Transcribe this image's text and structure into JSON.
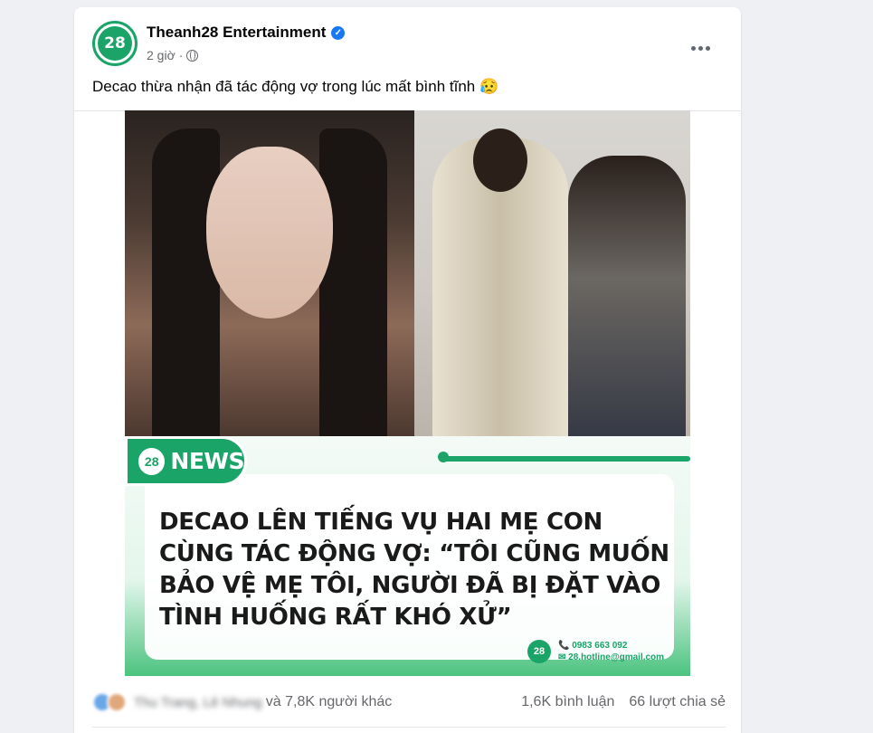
{
  "post": {
    "page_name": "Theanh28 Entertainment",
    "avatar_text": "28",
    "time": "2 giờ",
    "separator": "·",
    "caption": "Decao thừa nhận đã tác động vợ trong lúc mất bình tĩnh 😥"
  },
  "image": {
    "news_logo": "28",
    "news_label": "NEWS",
    "headline": "DECAO LÊN TIẾNG VỤ HAI MẸ CON CÙNG TÁC ĐỘNG VỢ: “TÔI CŨNG MUỐN BẢO VỆ MẸ TÔI, NGƯỜI ĐÃ BỊ ĐẶT VÀO TÌNH HUỐNG RẤT KHÓ XỬ”",
    "contact_logo": "28",
    "phone": "0983 663 092",
    "email": "28.hotline@gmail.com"
  },
  "footer": {
    "blurred_names": "Thu Trang, Lê Nhung",
    "others": "và 7,8K người khác",
    "comments": "1,6K bình luận",
    "shares": "66 lượt chia sẻ"
  },
  "colors": {
    "brand_green": "#1aa468",
    "verified_blue": "#1877f2"
  }
}
